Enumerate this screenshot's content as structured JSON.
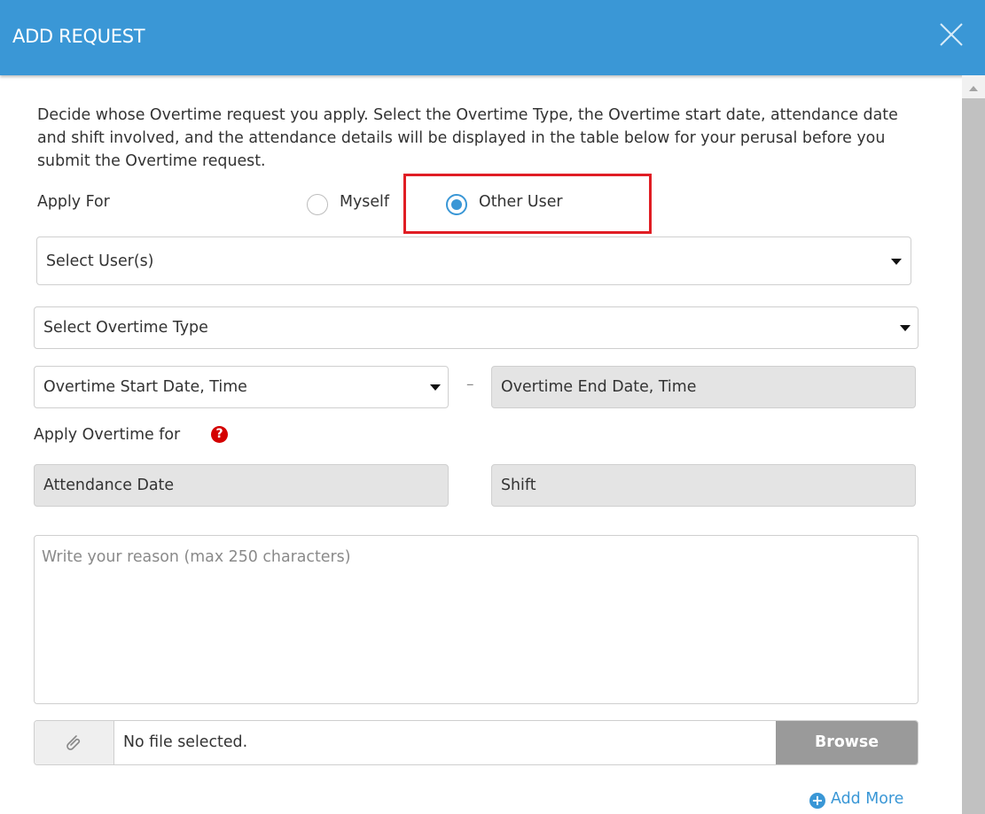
{
  "dialog": {
    "title": "ADD REQUEST",
    "close_icon": "close-icon"
  },
  "description": "Decide whose Overtime request you apply. Select the Overtime Type, the Overtime start date, attendance date and shift involved, and the attendance details will be displayed in the table below for your perusal before you submit the Overtime request.",
  "apply_for": {
    "label": "Apply For",
    "options": [
      {
        "label": "Myself",
        "selected": false
      },
      {
        "label": "Other User",
        "selected": true
      }
    ],
    "highlight_color": "#e01d24"
  },
  "fields": {
    "select_users": "Select User(s)",
    "overtime_type": "Select Overtime Type",
    "start_datetime": "Overtime Start Date, Time",
    "separator": "–",
    "end_datetime": "Overtime End Date, Time",
    "apply_overtime_for_label": "Apply Overtime for",
    "help_icon": "question-circle-icon",
    "attendance_date": "Attendance Date",
    "shift": "Shift",
    "reason_placeholder": "Write your reason (max 250 characters)"
  },
  "attachment": {
    "icon": "paperclip-icon",
    "status": "No file selected.",
    "browse_label": "Browse"
  },
  "add_more": {
    "icon": "plus-circle-icon",
    "label": "Add More"
  },
  "colors": {
    "header": "#3a97d6",
    "accent": "#3a97d6",
    "help": "#d40000"
  }
}
